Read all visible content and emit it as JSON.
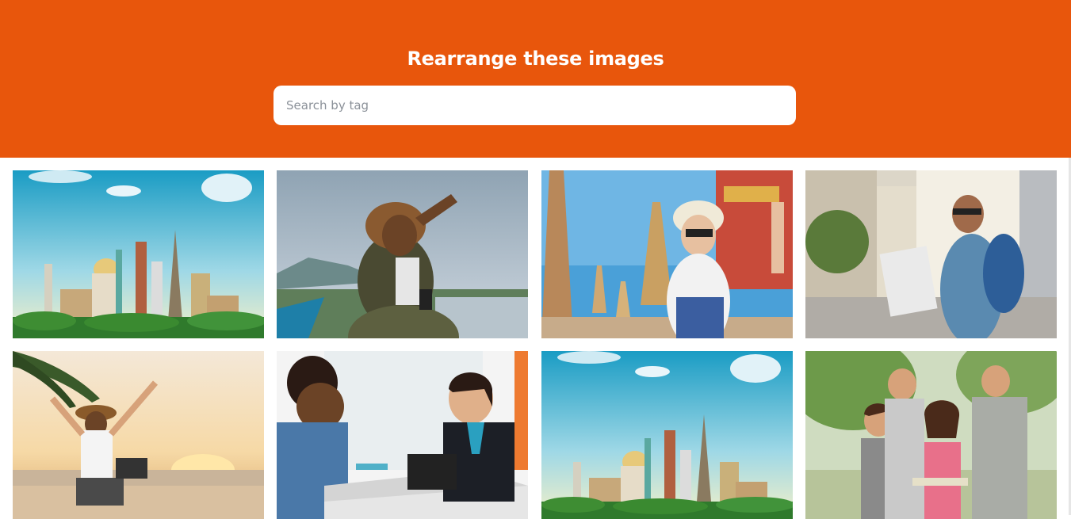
{
  "header": {
    "title": "Rearrange these images",
    "background_color": "#e8560c"
  },
  "search": {
    "placeholder": "Search by tag",
    "value": ""
  },
  "gallery": {
    "images": [
      {
        "icon": "landmarks-collage-image"
      },
      {
        "icon": "woman-hat-binoculars-image"
      },
      {
        "icon": "woman-selfie-temple-image"
      },
      {
        "icon": "man-map-city-image"
      },
      {
        "icon": "woman-beach-laptop-image"
      },
      {
        "icon": "airport-checkin-desk-image"
      },
      {
        "icon": "landmarks-collage-image"
      },
      {
        "icon": "friends-park-map-image"
      }
    ]
  }
}
